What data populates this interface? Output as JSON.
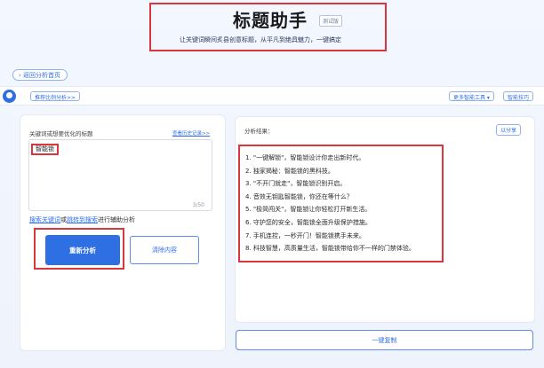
{
  "header": {
    "title": "标题助手",
    "beta_badge": "测试版",
    "subtitle": "让关键词瞬间炙县创意标题，从平凡到绝具魅力，一键搞定"
  },
  "nav": {
    "back_label": "返回分析首页"
  },
  "topbar": {
    "left_chip": "推荐比例分析>>",
    "more_tools": "更多智能工具 ▾",
    "smart_tips": "智能技巧"
  },
  "input_panel": {
    "prompt_label": "关键词或想要优化的标题",
    "history_link": "查看历史记录>>",
    "input_value": "智能锁",
    "counter": "3/50",
    "helper_links": [
      "搜索关键词",
      "跳转到搜索"
    ],
    "helper_text_prefix": "或",
    "helper_text_suffix": "进行辅助分析",
    "analyze_button": "重新分析",
    "clear_button": "清除内容"
  },
  "result_panel": {
    "title": "分析结果：",
    "view_button": "以分享",
    "results": [
      "1. \"一键解锁\"，智能锁设计你走出新时代。",
      "2. 独家揭秘：智能锁的黑科技。",
      "3. \"不开门就走\"，智能锁识别开启。",
      "4. 音效无钥匙智能锁，你还在等什么？",
      "5. \"极简闯关\"，智能锁让你轻松打开新生活。",
      "6. 守护您的安全，智能锁全面升级保护措施。",
      "7. 手机连控，一秒开门！智能锁携手未来。",
      "8. 科技智慧，高质量生活，智能锁带给你不一样的门禁体验。"
    ],
    "copy_button": "一键复制"
  }
}
